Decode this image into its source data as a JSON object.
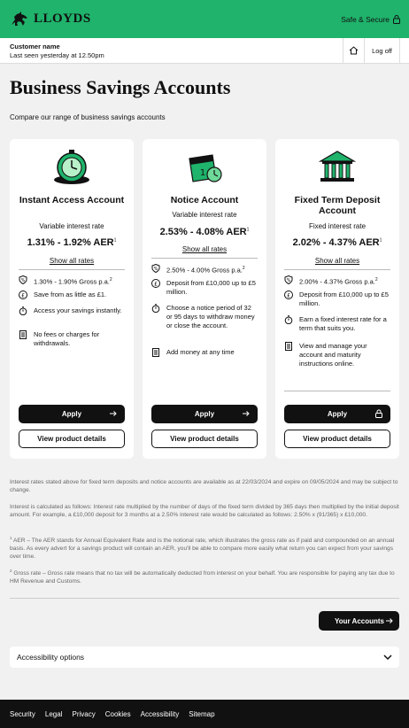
{
  "header": {
    "brand": "LLOYDS",
    "safe_secure": "Safe & Secure"
  },
  "user": {
    "name": "Customer name",
    "last_seen": "Last seen yesterday at 12.50pm",
    "logoff": "Log off"
  },
  "page": {
    "title": "Business Savings Accounts",
    "subtitle": "Compare our range of business savings accounts"
  },
  "cards": [
    {
      "title": "Instant Access Account",
      "type": "Variable interest rate",
      "rate": "1.31% - 1.92% AER",
      "rate_sup": "1",
      "show_rates": "Show all rates",
      "features": [
        {
          "text": "1.30% - 1.90% Gross p.a.",
          "sup": "2"
        },
        {
          "text": "Save from as little as £1.",
          "sup": ""
        },
        {
          "text": "Access your savings instantly.",
          "sup": ""
        },
        {
          "text": "No fees or charges for withdrawals.",
          "sup": ""
        }
      ],
      "apply": "Apply",
      "details": "View product details"
    },
    {
      "title": "Notice Account",
      "type": "Variable interest rate",
      "rate": "2.53% - 4.08% AER",
      "rate_sup": "1",
      "show_rates": "Show all rates",
      "features": [
        {
          "text": "2.50% - 4.00% Gross p.a.",
          "sup": "2"
        },
        {
          "text": "Deposit from £10,000 up to £5 million.",
          "sup": ""
        },
        {
          "text": "Choose a notice period of 32 or 95 days to withdraw money or close the account.",
          "sup": ""
        },
        {
          "text": "Add money at any time",
          "sup": ""
        }
      ],
      "apply": "Apply",
      "details": "View product details"
    },
    {
      "title": "Fixed Term Deposit Account",
      "type": "Fixed interest rate",
      "rate": "2.02% - 4.37% AER",
      "rate_sup": "1",
      "show_rates": "Show all rates",
      "features": [
        {
          "text": "2.00% - 4.37% Gross p.a.",
          "sup": "2"
        },
        {
          "text": "Deposit from £10,000 up to £5 million.",
          "sup": ""
        },
        {
          "text": "Earn a fixed interest rate for a term that suits you.",
          "sup": ""
        },
        {
          "text": "View and manage your account and maturity instructions online.",
          "sup": ""
        }
      ],
      "apply": "Apply",
      "details": "View product details"
    }
  ],
  "notes": {
    "n1": "Interest rates stated above for fixed term deposits and notice accounts are available as at 22/03/2024 and expire on 09/05/2024 and may be subject to change.",
    "n2": "Interest is calculated as follows: Interest rate multiplied by the number of days of the fixed term divided by 365 days then multiplied by the initial deposit amount. For example, a £10,000 deposit for 3 months at a 2.50% interest rate would be calculated as follows: 2.50% x (91/365) x £10,000.",
    "n3_sup": "1",
    "n3": "AER – The AER stands for Annual Equivalent Rate and is the notional rate, which illustrates the gross rate as if paid and compounded on an annual basis. As every advert for a savings product will contain an AER, you'll be able to compare more easily what return you can expect from your savings over time.",
    "n4_sup": "2",
    "n4": "Gross rate – Gross rate means that no tax will be automatically deducted from interest on your behalf. You are responsible for paying any tax due to HM Revenue and Customs."
  },
  "your_accounts": "Your Accounts",
  "accessibility": "Accessibility options",
  "footer": [
    "Security",
    "Legal",
    "Privacy",
    "Cookies",
    "Accessibility",
    "Sitemap"
  ],
  "colors": {
    "brand_green": "#1fb36b",
    "dark": "#111111"
  }
}
